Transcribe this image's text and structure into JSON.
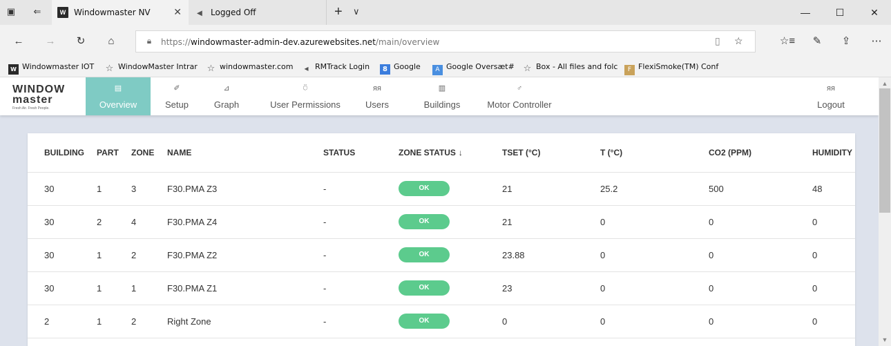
{
  "browser": {
    "tabs": [
      {
        "title": "Windowmaster NV",
        "favicon": "windowmaster-logo-icon",
        "close": "✕"
      },
      {
        "title": "Logged Off",
        "favicon": "arrow-icon"
      }
    ],
    "new_tab": "+",
    "tab_list": "∨",
    "window_controls": {
      "minimize": "—",
      "maximize": "☐",
      "close": "✕"
    },
    "nav": {
      "back": "←",
      "forward": "→",
      "refresh": "↻",
      "home": "⌂"
    },
    "url": {
      "prefix": "https://",
      "host": "windowmaster-admin-dev.azurewebsites.net",
      "path": "/main/overview"
    },
    "toolbar_icons": {
      "reading_view": "▯",
      "favorite": "☆",
      "favorites_list": "☆≡",
      "notes": "✎",
      "share": "⇪",
      "more": "⋯"
    }
  },
  "favorites": [
    {
      "label": "Windowmaster IOT",
      "icon": "wm"
    },
    {
      "label": "WindowMaster Intrar",
      "icon": "star"
    },
    {
      "label": "windowmaster.com",
      "icon": "star"
    },
    {
      "label": "RMTrack Login",
      "icon": "arrow"
    },
    {
      "label": "Google",
      "icon": "google"
    },
    {
      "label": "Google Oversæt#",
      "icon": "trans"
    },
    {
      "label": "Box - All files and folc",
      "icon": "star"
    },
    {
      "label": "FlexiSmoke(TM) Conf",
      "icon": "flexi"
    }
  ],
  "app": {
    "logo": {
      "line1": "WINDOW",
      "line2": "master",
      "tagline": "Fresh Air. Fresh People."
    },
    "menu": [
      {
        "label": "Overview",
        "icon": "▤"
      },
      {
        "label": "Setup",
        "icon": "✐"
      },
      {
        "label": "Graph",
        "icon": "⊿"
      },
      {
        "label": "User Permissions",
        "icon": "⍥"
      },
      {
        "label": "Users",
        "icon": "ᴙᴙ"
      },
      {
        "label": "Buildings",
        "icon": "▥"
      },
      {
        "label": "Motor Controller",
        "icon": "♂"
      },
      {
        "label": "Logout",
        "icon": "ᴙᴙ"
      }
    ],
    "table": {
      "headers": [
        "BUILDING",
        "PART",
        "ZONE",
        "NAME",
        "STATUS",
        "ZONE STATUS",
        "TSET (°C)",
        "T (°C)",
        "CO2 (PPM)",
        "HUMIDITY"
      ],
      "sort_indicator": "↓",
      "rows": [
        {
          "building": "30",
          "part": "1",
          "zone": "3",
          "name": "F30.PMA Z3",
          "status": "-",
          "zone_status": "OK",
          "tset": "21",
          "t": "25.2",
          "co2": "500",
          "humidity": "48"
        },
        {
          "building": "30",
          "part": "2",
          "zone": "4",
          "name": "F30.PMA Z4",
          "status": "-",
          "zone_status": "OK",
          "tset": "21",
          "t": "0",
          "co2": "0",
          "humidity": "0"
        },
        {
          "building": "30",
          "part": "1",
          "zone": "2",
          "name": "F30.PMA Z2",
          "status": "-",
          "zone_status": "OK",
          "tset": "23.88",
          "t": "0",
          "co2": "0",
          "humidity": "0"
        },
        {
          "building": "30",
          "part": "1",
          "zone": "1",
          "name": "F30.PMA Z1",
          "status": "-",
          "zone_status": "OK",
          "tset": "23",
          "t": "0",
          "co2": "0",
          "humidity": "0"
        },
        {
          "building": "2",
          "part": "1",
          "zone": "2",
          "name": "Right Zone",
          "status": "-",
          "zone_status": "OK",
          "tset": "0",
          "t": "0",
          "co2": "0",
          "humidity": "0"
        }
      ]
    }
  },
  "colors": {
    "accent": "#7fcbc4",
    "ok_pill": "#5ccb8d",
    "page_bg": "#dde2ec"
  }
}
